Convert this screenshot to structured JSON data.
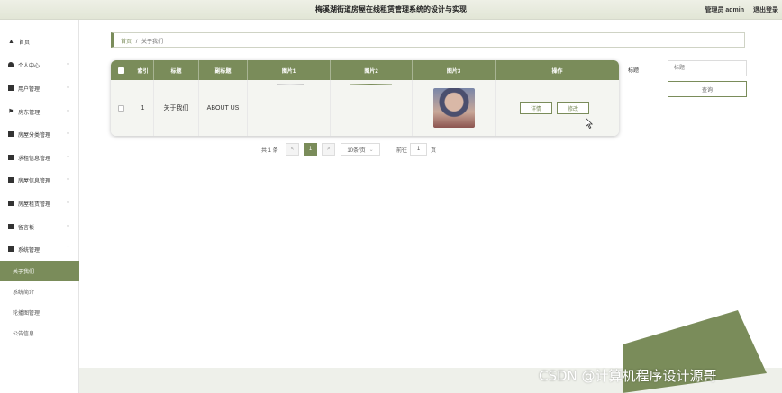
{
  "header": {
    "title": "梅溪湖街道房屋在线租赁管理系统的设计与实现",
    "user_label": "管理员 admin",
    "logout_label": "退出登录"
  },
  "sidebar": {
    "items": [
      {
        "label": "首页",
        "icon": "home-icon"
      },
      {
        "label": "个人中心",
        "icon": "user-icon"
      },
      {
        "label": "用户管理",
        "icon": "grid-icon"
      },
      {
        "label": "房东管理",
        "icon": "flag-icon"
      },
      {
        "label": "房屋分类管理",
        "icon": "box-icon"
      },
      {
        "label": "求租信息管理",
        "icon": "grid-icon"
      },
      {
        "label": "房屋信息管理",
        "icon": "grid-icon"
      },
      {
        "label": "房屋租赁管理",
        "icon": "box-icon"
      },
      {
        "label": "留言板",
        "icon": "board-icon"
      },
      {
        "label": "系统管理",
        "icon": "check-icon"
      }
    ],
    "sub_items": [
      {
        "label": "关于我们",
        "active": true
      },
      {
        "label": "系统简介",
        "active": false
      },
      {
        "label": "轮播图管理",
        "active": false
      },
      {
        "label": "公告信息",
        "active": false
      }
    ]
  },
  "breadcrumb": {
    "home": "首页",
    "separator": "/",
    "current": "关于我们"
  },
  "table": {
    "headers": [
      "索引",
      "标题",
      "副标题",
      "图片1",
      "图片2",
      "图片3",
      "操作"
    ],
    "rows": [
      {
        "index": "1",
        "title": "关于我们",
        "subtitle": "ABOUT US",
        "detail_label": "详情",
        "edit_label": "修改"
      }
    ]
  },
  "filter": {
    "label": "标题",
    "placeholder": "标题",
    "search_label": "查询"
  },
  "pagination": {
    "total": "共 1 条",
    "prev": "<",
    "current_page": "1",
    "next": ">",
    "page_size": "10条/页",
    "goto_prefix": "前往",
    "goto_value": "1",
    "goto_suffix": "页"
  },
  "watermark": "CSDN @计算机程序设计源哥",
  "colors": {
    "accent": "#7a8c5a",
    "header_bg": "#e6e9dc"
  }
}
